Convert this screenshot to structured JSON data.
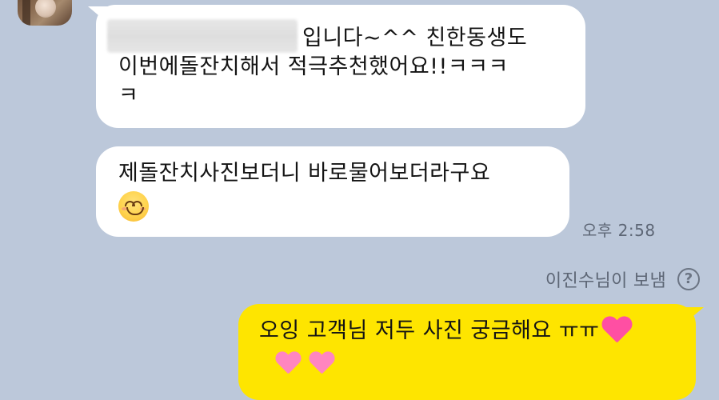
{
  "conversation": {
    "incoming": [
      {
        "lines": [
          "입니다~^^ 친한동생도",
          "이번에돌잔치해서 적극추천했어요!!ㅋㅋㅋ",
          "ㅋ"
        ],
        "redacted_name": true
      },
      {
        "lines": [
          "제돌잔치사진보더니 바로물어보더라구요"
        ],
        "emoji": "smiling-face-icon",
        "time": "오후 2:58"
      }
    ],
    "sender_notice": "이진수님이 보냄",
    "outgoing": {
      "line1": "오잉 고객님 저두 사진 궁금해요 ㅠㅠ",
      "line1_emoji": "pink-heart-icon",
      "line2_emojis": [
        "pink-heart-icon",
        "pink-heart-icon"
      ]
    }
  },
  "colors": {
    "background": "#bcc8da",
    "incoming_bubble": "#ffffff",
    "outgoing_bubble": "#fee500",
    "meta_text": "#5d6675",
    "heart": "#ff4fa3"
  }
}
